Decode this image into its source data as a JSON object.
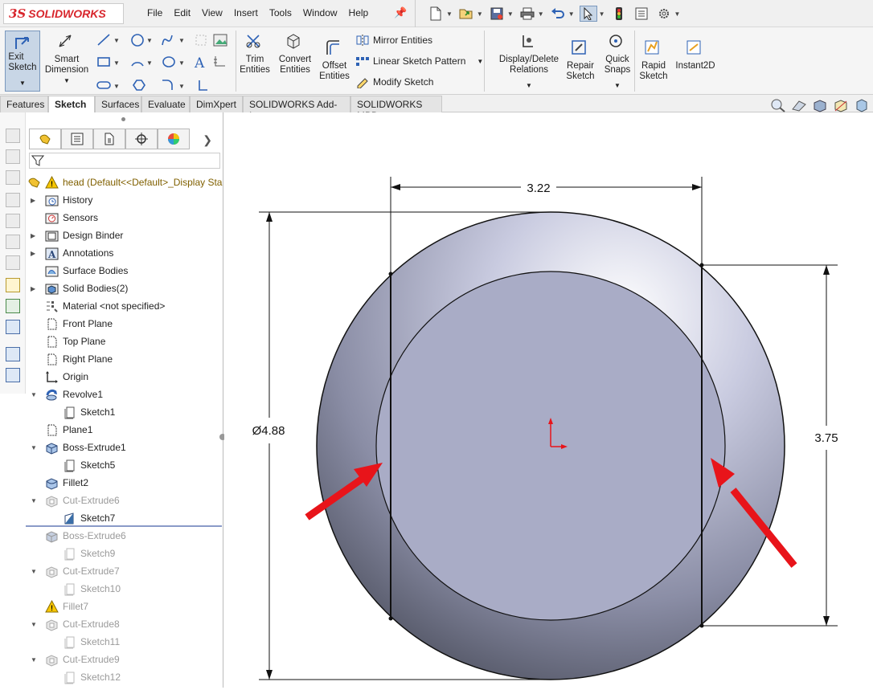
{
  "app": {
    "logo_ds": "3S",
    "logo_text": "SOLIDWORKS"
  },
  "menu": [
    "File",
    "Edit",
    "View",
    "Insert",
    "Tools",
    "Window",
    "Help"
  ],
  "qat_icons": [
    "new-icon",
    "open-icon",
    "save-icon",
    "print-icon",
    "undo-icon",
    "select-icon",
    "traffic-light-icon",
    "file-properties-icon",
    "options-icon"
  ],
  "ribbon": {
    "exit_sketch": "Exit\nSketch",
    "smart_dimension": "Smart\nDimension",
    "trim_entities": "Trim\nEntities",
    "convert_entities": "Convert\nEntities",
    "offset_entities": "Offset\nEntities",
    "mirror_entities": "Mirror Entities",
    "linear_sketch_pattern": "Linear Sketch Pattern",
    "modify_sketch": "Modify Sketch",
    "display_delete_relations": "Display/Delete\nRelations",
    "repair_sketch": "Repair\nSketch",
    "quick_snaps": "Quick\nSnaps",
    "rapid_sketch": "Rapid\nSketch",
    "instant2d": "Instant2D"
  },
  "tabs": [
    "Features",
    "Sketch",
    "Surfaces",
    "Evaluate",
    "DimXpert",
    "SOLIDWORKS Add-Ins",
    "SOLIDWORKS MBD"
  ],
  "active_tab": "Sketch",
  "tree": {
    "root": "head  (Default<<Default>_Display Sta",
    "items": [
      {
        "label": "History",
        "expand": true,
        "indent": 0,
        "icon": "history-icon",
        "dim": false
      },
      {
        "label": "Sensors",
        "expand": false,
        "indent": 0,
        "icon": "sensors-icon",
        "dim": false
      },
      {
        "label": "Design Binder",
        "expand": true,
        "indent": 0,
        "icon": "design-binder-icon",
        "dim": false
      },
      {
        "label": "Annotations",
        "expand": true,
        "indent": 0,
        "icon": "annotations-icon",
        "dim": false
      },
      {
        "label": "Surface Bodies",
        "expand": false,
        "indent": 0,
        "icon": "surface-bodies-icon",
        "dim": false
      },
      {
        "label": "Solid Bodies(2)",
        "expand": true,
        "indent": 0,
        "icon": "solid-bodies-icon",
        "dim": false
      },
      {
        "label": "Material <not specified>",
        "expand": false,
        "indent": 0,
        "icon": "material-icon",
        "dim": false
      },
      {
        "label": "Front Plane",
        "expand": false,
        "indent": 0,
        "icon": "plane-icon",
        "dim": false
      },
      {
        "label": "Top Plane",
        "expand": false,
        "indent": 0,
        "icon": "plane-icon",
        "dim": false
      },
      {
        "label": "Right Plane",
        "expand": false,
        "indent": 0,
        "icon": "plane-icon",
        "dim": false
      },
      {
        "label": "Origin",
        "expand": false,
        "indent": 0,
        "icon": "origin-icon",
        "dim": false
      },
      {
        "label": "Revolve1",
        "expand": "open",
        "indent": 0,
        "icon": "revolve-icon",
        "dim": false
      },
      {
        "label": "Sketch1",
        "expand": false,
        "indent": 1,
        "icon": "sketch-icon",
        "dim": false
      },
      {
        "label": "Plane1",
        "expand": false,
        "indent": 0,
        "icon": "plane-icon",
        "dim": false
      },
      {
        "label": "Boss-Extrude1",
        "expand": "open",
        "indent": 0,
        "icon": "boss-extrude-icon",
        "dim": false
      },
      {
        "label": "Sketch5",
        "expand": false,
        "indent": 1,
        "icon": "sketch-icon",
        "dim": false
      },
      {
        "label": "Fillet2",
        "expand": false,
        "indent": 0,
        "icon": "fillet-icon",
        "dim": false
      },
      {
        "label": "Cut-Extrude6",
        "expand": "open",
        "indent": 0,
        "icon": "cut-extrude-icon",
        "dim": true
      },
      {
        "label": "Sketch7",
        "expand": false,
        "indent": 1,
        "icon": "sketch-active-icon",
        "dim": false
      },
      {
        "label": "Boss-Extrude6",
        "expand": false,
        "indent": 0,
        "icon": "boss-extrude-icon",
        "dim": true
      },
      {
        "label": "Sketch9",
        "expand": false,
        "indent": 1,
        "icon": "sketch-icon",
        "dim": true
      },
      {
        "label": "Cut-Extrude7",
        "expand": "open",
        "indent": 0,
        "icon": "cut-extrude-icon",
        "dim": true
      },
      {
        "label": "Sketch10",
        "expand": false,
        "indent": 1,
        "icon": "sketch-icon",
        "dim": true
      },
      {
        "label": "Fillet7",
        "expand": false,
        "indent": 0,
        "icon": "fillet-warning-icon",
        "dim": true
      },
      {
        "label": "Cut-Extrude8",
        "expand": "open",
        "indent": 0,
        "icon": "cut-extrude-icon",
        "dim": true
      },
      {
        "label": "Sketch11",
        "expand": false,
        "indent": 1,
        "icon": "sketch-icon",
        "dim": true
      },
      {
        "label": "Cut-Extrude9",
        "expand": "open",
        "indent": 0,
        "icon": "cut-extrude-icon",
        "dim": true
      },
      {
        "label": "Sketch12",
        "expand": false,
        "indent": 1,
        "icon": "sketch-icon",
        "dim": true
      }
    ]
  },
  "dimensions": {
    "width": "3.22",
    "height": "3.75",
    "diameter": "Ø4.88"
  },
  "colors": {
    "accent": "#d8262d",
    "arrow": "#e8141a",
    "inner_face": "#a9acc6"
  }
}
